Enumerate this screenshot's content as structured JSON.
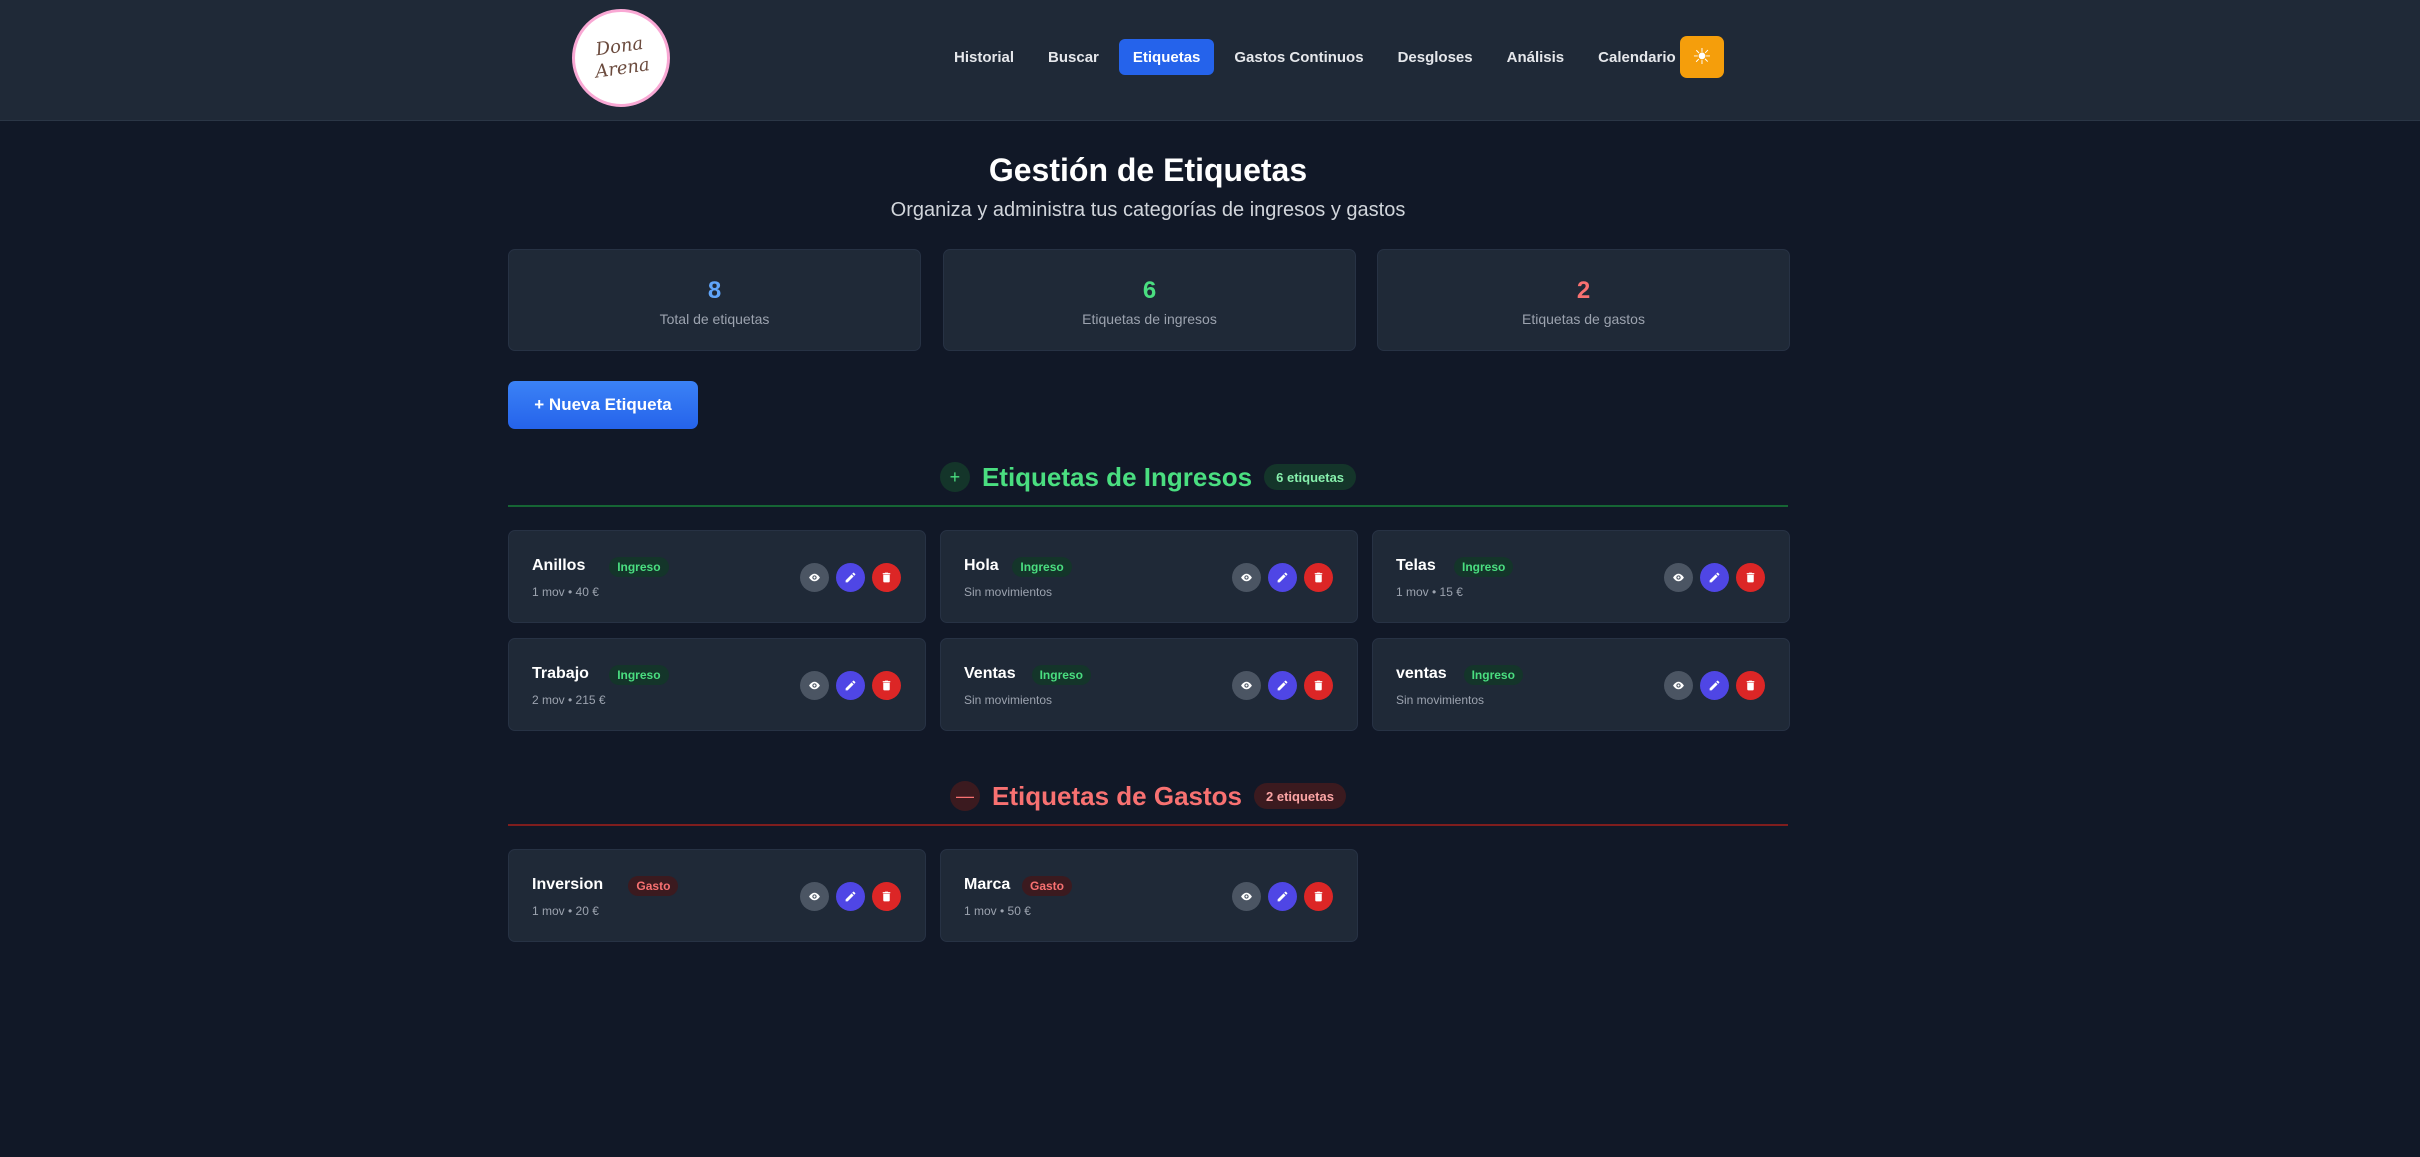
{
  "brand": {
    "logo_text": "Dona Arena"
  },
  "nav": {
    "items": [
      {
        "label": "Historial",
        "active": false
      },
      {
        "label": "Buscar",
        "active": false
      },
      {
        "label": "Etiquetas",
        "active": true
      },
      {
        "label": "Gastos Continuos",
        "active": false
      },
      {
        "label": "Desgloses",
        "active": false
      },
      {
        "label": "Análisis",
        "active": false
      },
      {
        "label": "Calendario",
        "active": false
      }
    ],
    "theme_icon": "☀"
  },
  "header": {
    "title": "Gestión de Etiquetas",
    "subtitle": "Organiza y administra tus categorías de ingresos y gastos"
  },
  "stats": [
    {
      "value": "8",
      "label": "Total de etiquetas",
      "color": "#60a5fa"
    },
    {
      "value": "6",
      "label": "Etiquetas de ingresos",
      "color": "#4ade80"
    },
    {
      "value": "2",
      "label": "Etiquetas de gastos",
      "color": "#f87171"
    }
  ],
  "new_button": {
    "label": "+ Nueva Etiqueta"
  },
  "income": {
    "icon": "+",
    "title": "Etiquetas de Ingresos",
    "badge": "6 etiquetas",
    "color": "#4ade80",
    "tags": [
      {
        "name": "Anillos",
        "type": "Ingreso",
        "meta": "1 mov • 40 €"
      },
      {
        "name": "Hola",
        "type": "Ingreso",
        "meta": "Sin movimientos"
      },
      {
        "name": "Telas",
        "type": "Ingreso",
        "meta": "1 mov • 15 €"
      },
      {
        "name": "Trabajo",
        "type": "Ingreso",
        "meta": "2 mov • 215 €"
      },
      {
        "name": "Ventas",
        "type": "Ingreso",
        "meta": "Sin movimientos"
      },
      {
        "name": "ventas",
        "type": "Ingreso",
        "meta": "Sin movimientos"
      }
    ]
  },
  "expense": {
    "icon": "—",
    "title": "Etiquetas de Gastos",
    "badge": "2 etiquetas",
    "color": "#f87171",
    "tags": [
      {
        "name": "Inversion",
        "type": "Gasto",
        "meta": "1 mov • 20 €"
      },
      {
        "name": "Marca",
        "type": "Gasto",
        "meta": "1 mov • 50 €"
      }
    ]
  }
}
